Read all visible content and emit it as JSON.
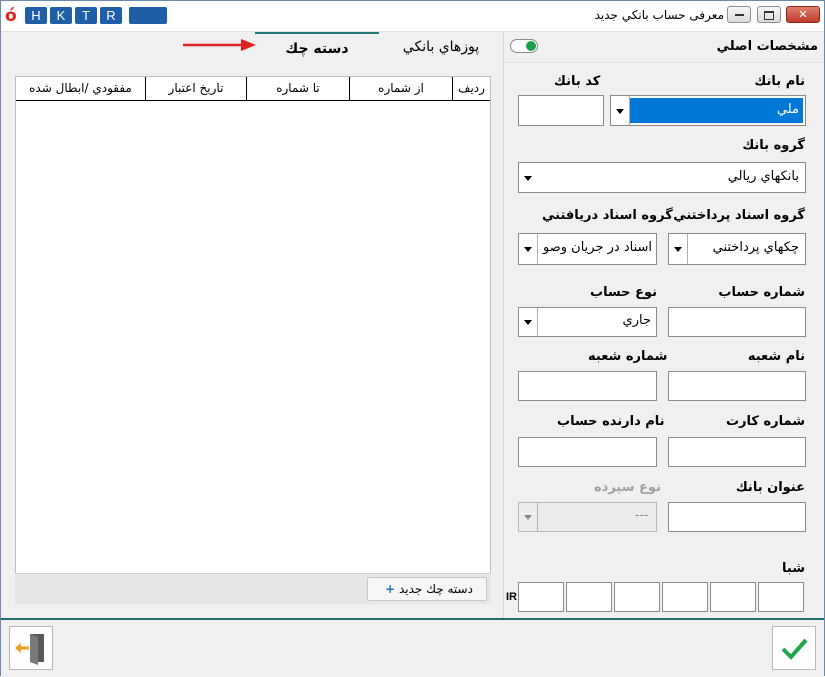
{
  "window": {
    "title": "معرفی حساب بانکي جديد",
    "hotkeys": [
      "H",
      "K",
      "T",
      "R"
    ],
    "minimize_icon": "minimize-icon",
    "restore_icon": "restore-icon",
    "close_icon": "close-icon"
  },
  "right_panel": {
    "section_title": "مشخصات اصلي",
    "toggle_state": "on",
    "bank_name_label": "نام بانك",
    "bank_name_value": "ملي",
    "bank_code_label": "كد بانك",
    "bank_code_value": "",
    "bank_group_label": "گروه بانك",
    "bank_group_value": "بانکهاي ريالي",
    "paid_docs_label": "گروه اسناد پرداختني",
    "paid_docs_value": "چكهاي پرداختني",
    "received_docs_label": "گروه اسناد دريافتني",
    "received_docs_value": "اسناد در جريان وصو",
    "account_number_label": "شماره حساب",
    "account_number_value": "",
    "account_type_label": "نوع حساب",
    "account_type_value": "جاري",
    "branch_name_label": "نام شعبه",
    "branch_name_value": "",
    "branch_number_label": "شماره شعبه",
    "branch_number_value": "",
    "card_number_label": "شماره كارت",
    "card_number_value": "",
    "account_holder_label": "نام دارنده حساب",
    "account_holder_value": "",
    "bank_title_label": "عنوان بانك",
    "bank_title_value": "",
    "deposit_type_label": "نوع سپرده",
    "deposit_type_value": "---",
    "sheba_label": "شبا",
    "sheba_prefix": "IR",
    "sheba_segments": [
      "",
      "",
      "",
      "",
      "",
      ""
    ]
  },
  "left_panel": {
    "tabs": [
      {
        "label": "پوزهاي بانكي",
        "active": false
      },
      {
        "label": "دسته چك",
        "active": true
      }
    ],
    "columns": [
      "رديف",
      "از شماره",
      "تا شماره",
      "تاريخ اعتبار",
      "مفقودي /ابطال شده"
    ],
    "rows": [],
    "new_button_label": "دسته چك جديد",
    "new_button_icon": "plus-icon"
  },
  "footer": {
    "exit_icon": "exit-door-icon",
    "confirm_icon": "checkmark-icon"
  },
  "colors": {
    "selection_blue": "#0078d7",
    "accent_teal": "#1f6d6d",
    "hotkey_blue": "#1f5fa8",
    "toggle_green": "#1f9e4a",
    "arrow_red": "#e02020",
    "confirm_green": "#1fa84a"
  }
}
